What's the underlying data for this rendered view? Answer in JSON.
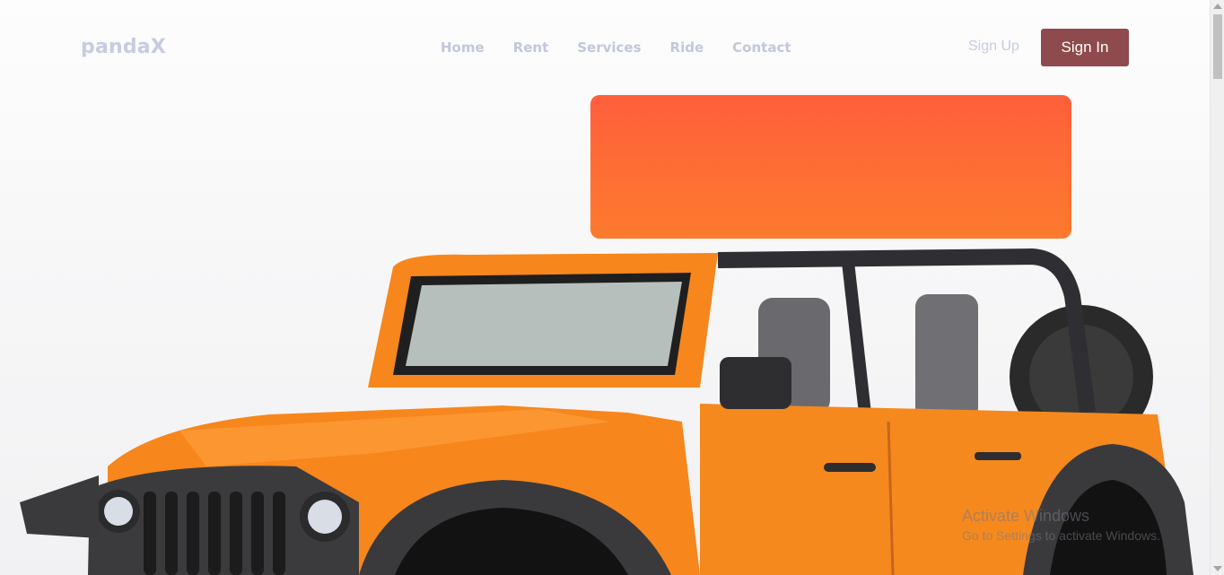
{
  "header": {
    "brand": "pandaX",
    "nav": [
      "Home",
      "Rent",
      "Services",
      "Ride",
      "Contact"
    ],
    "signup_label": "Sign Up",
    "signin_label": "Sign In"
  },
  "hero": {
    "image_icon": "orange-jeep-image",
    "promo_gradient": [
      "#ff5f3b",
      "#fd7a2e"
    ]
  },
  "watermark": {
    "title": "Activate Windows",
    "subtitle": "Go to Settings to activate Windows."
  },
  "colors": {
    "accent_button": "#8e4a4c",
    "nav_text": "#c2c7dc",
    "jeep_body": "#f7861c"
  }
}
